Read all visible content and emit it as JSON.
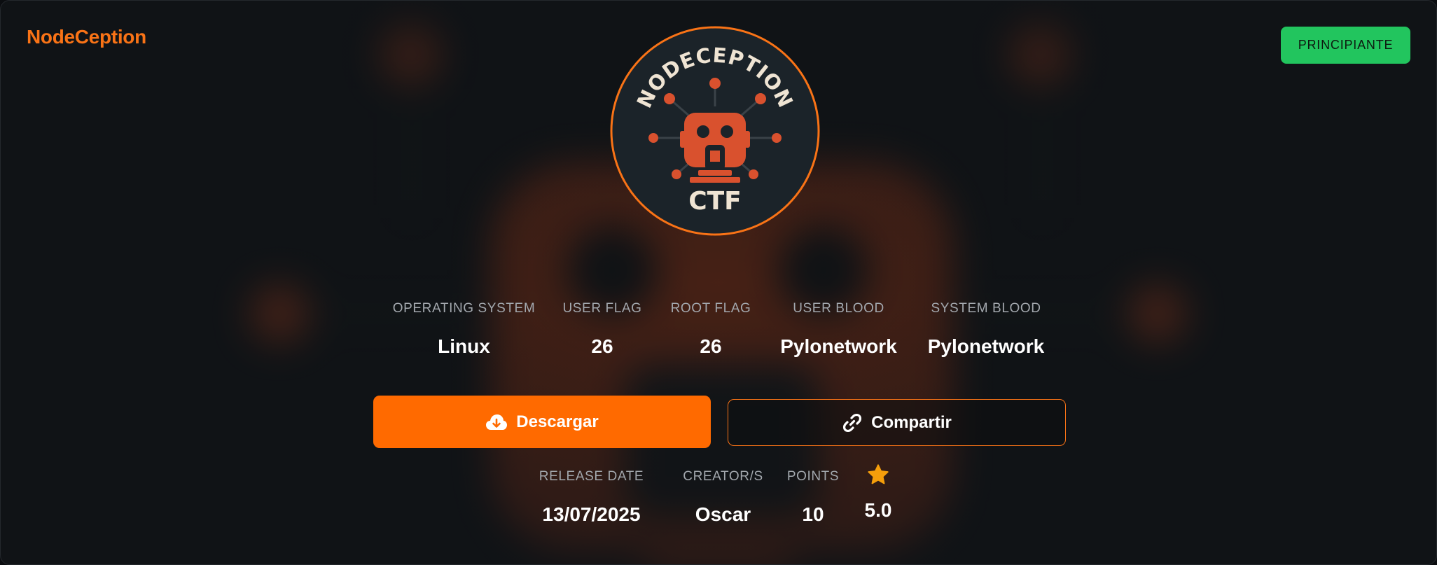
{
  "header": {
    "brand": "NodeCeption",
    "difficulty_badge": "PRINCIPIANTE"
  },
  "logo": {
    "top_text": "NODECEPTION",
    "bottom_text": "CTF",
    "icon": "robot-network-icon"
  },
  "machine_stats": [
    {
      "label": "OPERATING SYSTEM",
      "value": "Linux"
    },
    {
      "label": "USER FLAG",
      "value": "26"
    },
    {
      "label": "ROOT FLAG",
      "value": "26"
    },
    {
      "label": "USER BLOOD",
      "value": "Pylonetwork"
    },
    {
      "label": "SYSTEM BLOOD",
      "value": "Pylonetwork"
    }
  ],
  "actions": {
    "download_label": "Descargar",
    "download_icon": "cloud-download-icon",
    "share_label": "Compartir",
    "share_icon": "link-icon"
  },
  "meta_stats": {
    "release_date_label": "RELEASE DATE",
    "release_date": "13/07/2025",
    "creator_label": "CREATOR/S",
    "creator": "Oscar",
    "points_label": "POINTS",
    "points": "10",
    "rating_icon": "star-icon",
    "rating": "5.0"
  },
  "colors": {
    "accent": "#f97316",
    "button_primary": "#ff6a00",
    "badge": "#22c55e",
    "star": "#f59e0b",
    "background": "#101316"
  }
}
